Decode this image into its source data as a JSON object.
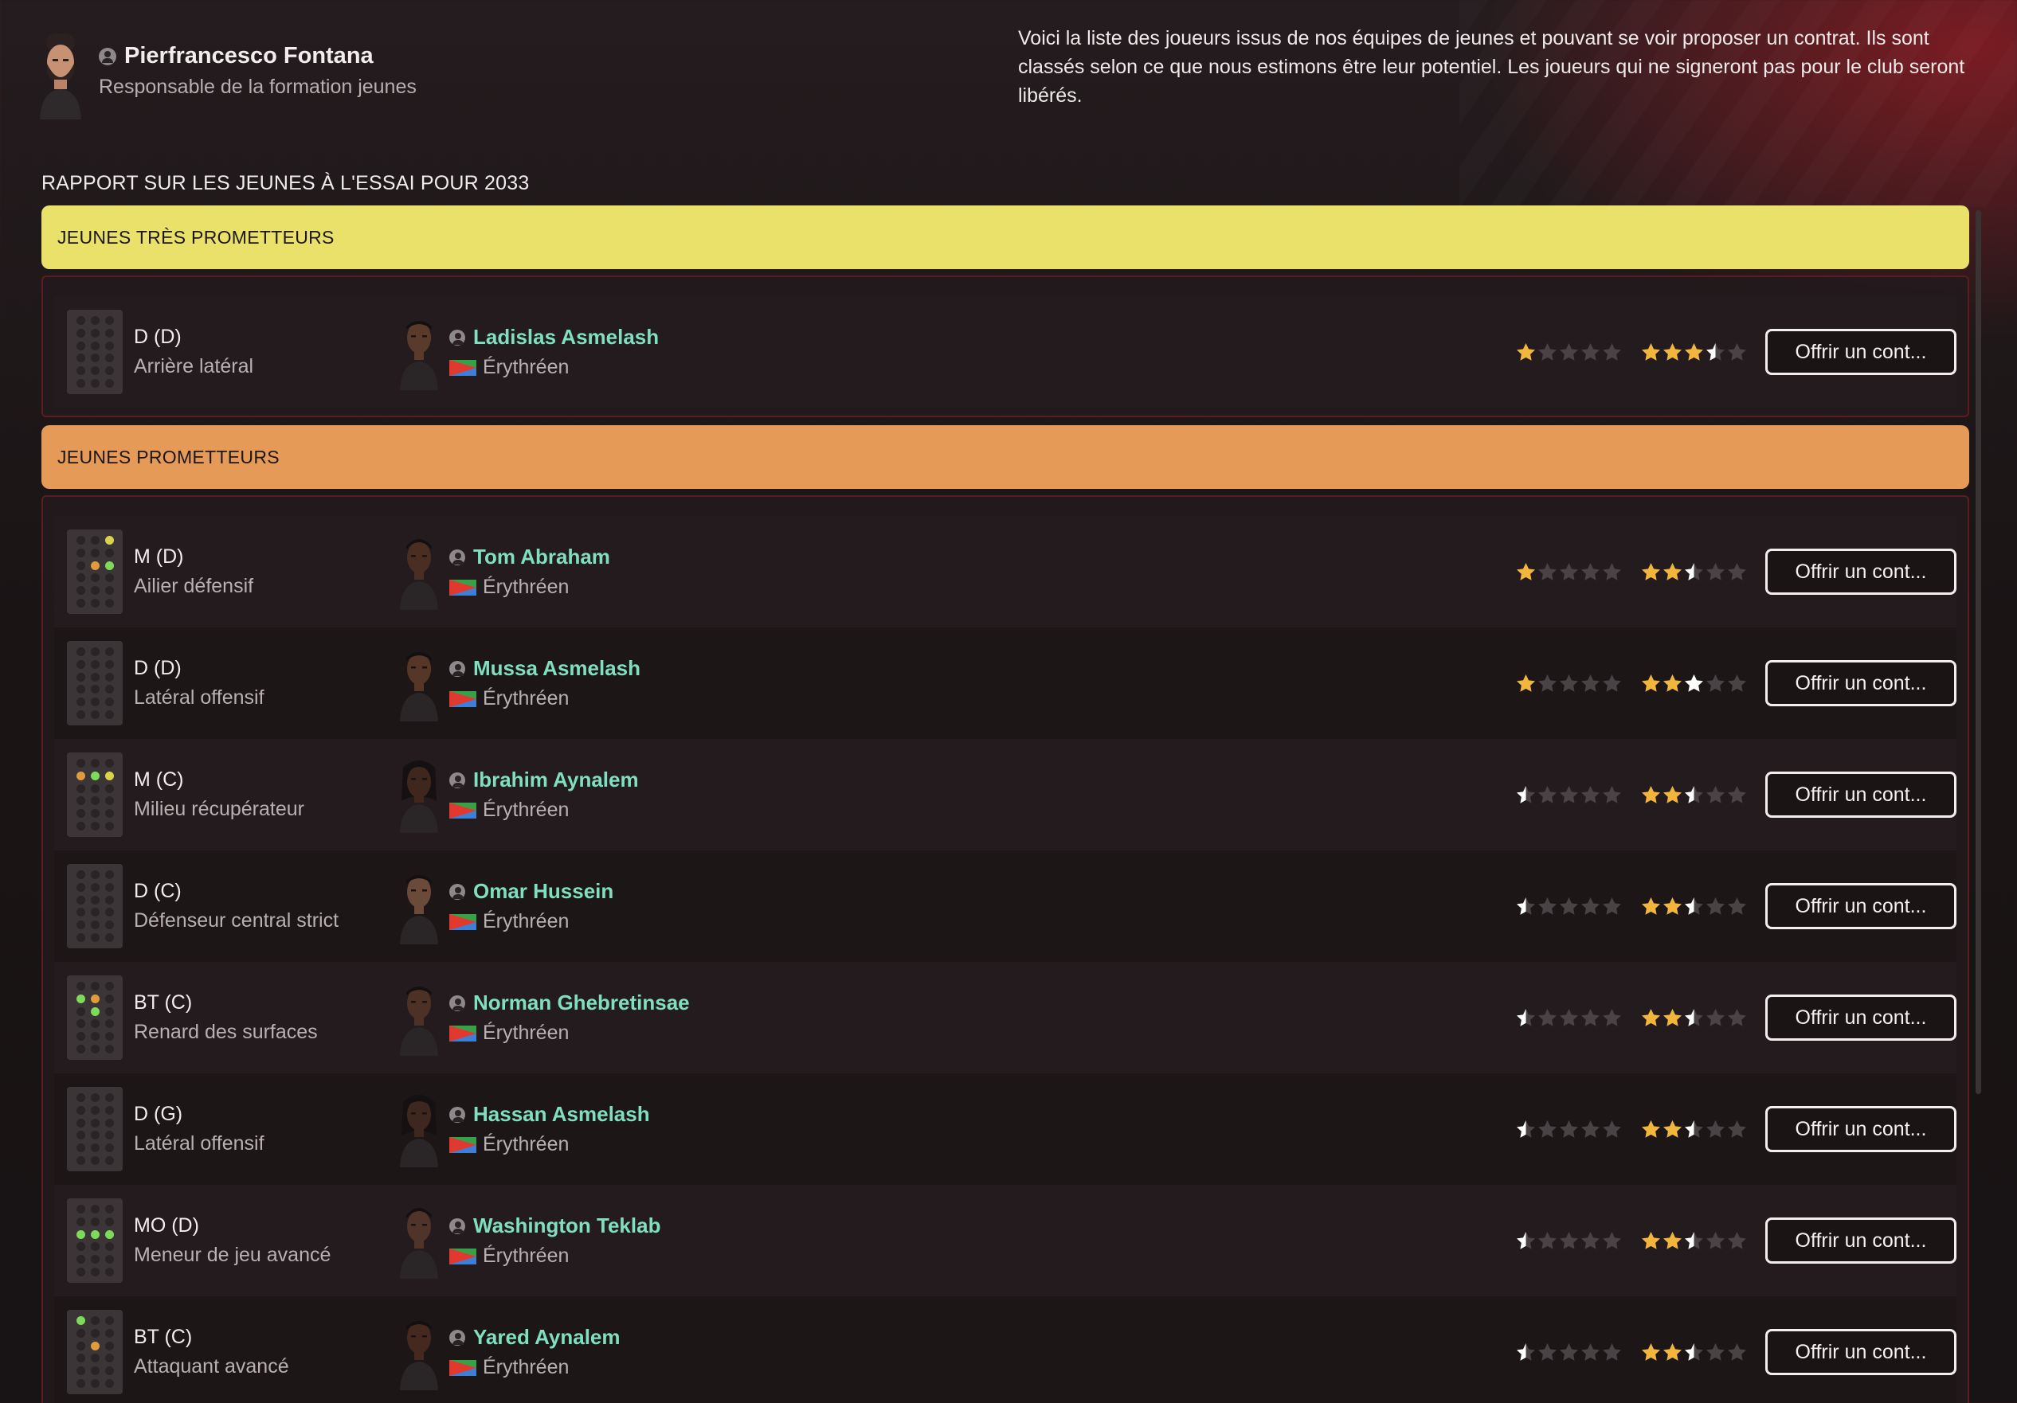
{
  "staff": {
    "name": "Pierfrancesco Fontana",
    "role": "Responsable de la formation jeunes"
  },
  "intro": "Voici la liste des joueurs issus de nos équipes de jeunes et pouvant se voir proposer un contrat. Ils sont classés selon ce que nous estimons être leur potentiel. Les joueurs qui ne signeront pas pour le club seront libérés.",
  "report_title": "RAPPORT SUR LES JEUNES À L'ESSAI POUR 2033",
  "colors": {
    "very_promising": "#e9e16a",
    "promising": "#e59a58",
    "player_name": "#7fdfc0",
    "star_gold": "#f2b63c",
    "star_white": "#ffffff",
    "star_empty": "#4a4345"
  },
  "groups": [
    {
      "title": "JEUNES TRÈS PROMETTEURS",
      "players": [
        {
          "pos": "D (D)",
          "role": "Arrière latéral",
          "name": "Ladislas Asmelash",
          "nationality": "Érythréen",
          "current_stars": 1,
          "potential_stars": 3.5,
          "button": "Offrir un cont..."
        }
      ]
    },
    {
      "title": "JEUNES PROMETTEURS",
      "players": [
        {
          "pos": "M (D)",
          "role": "Ailier défensif",
          "name": "Tom Abraham",
          "nationality": "Érythréen",
          "current_stars": 1,
          "potential_stars": 2.5,
          "button": "Offrir un cont..."
        },
        {
          "pos": "D (D)",
          "role": "Latéral offensif",
          "name": "Mussa Asmelash",
          "nationality": "Érythréen",
          "current_stars": 1,
          "potential_stars": 3,
          "button": "Offrir un cont..."
        },
        {
          "pos": "M (C)",
          "role": "Milieu récupérateur",
          "name": "Ibrahim Aynalem",
          "nationality": "Érythréen",
          "current_stars": 0.5,
          "potential_stars": 2.5,
          "button": "Offrir un cont..."
        },
        {
          "pos": "D (C)",
          "role": "Défenseur central strict",
          "name": "Omar Hussein",
          "nationality": "Érythréen",
          "current_stars": 0.5,
          "potential_stars": 2.5,
          "button": "Offrir un cont..."
        },
        {
          "pos": "BT (C)",
          "role": "Renard des surfaces",
          "name": "Norman Ghebretinsae",
          "nationality": "Érythréen",
          "current_stars": 0.5,
          "potential_stars": 2.5,
          "button": "Offrir un cont..."
        },
        {
          "pos": "D (G)",
          "role": "Latéral offensif",
          "name": "Hassan Asmelash",
          "nationality": "Érythréen",
          "current_stars": 0.5,
          "potential_stars": 2.5,
          "button": "Offrir un cont..."
        },
        {
          "pos": "MO (D)",
          "role": "Meneur de jeu avancé",
          "name": "Washington Teklab",
          "nationality": "Érythréen",
          "current_stars": 0.5,
          "potential_stars": 2.5,
          "button": "Offrir un cont..."
        },
        {
          "pos": "BT (C)",
          "role": "Attaquant avancé",
          "name": "Yared Aynalem",
          "nationality": "Érythréen",
          "current_stars": 0.5,
          "potential_stars": 2.5,
          "button": "Offrir un cont..."
        }
      ]
    }
  ]
}
